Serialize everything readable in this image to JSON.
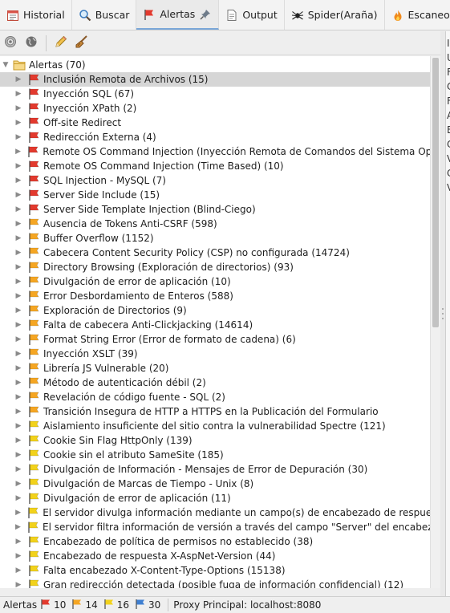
{
  "tabs": [
    {
      "label": "Historial",
      "icon": "history-icon"
    },
    {
      "label": "Buscar",
      "icon": "search-icon"
    },
    {
      "label": "Alertas",
      "icon": "alert-flag-icon"
    },
    {
      "label": "Output",
      "icon": "document-icon"
    },
    {
      "label": "Spider(Araña)",
      "icon": "spider-icon"
    },
    {
      "label": "Escaneo A",
      "icon": "flame-icon"
    }
  ],
  "toolbar": {
    "buttons": [
      "target-icon",
      "globe-icon",
      "pencil-icon",
      "broom-icon"
    ]
  },
  "tree": {
    "root_label": "Alertas (70)",
    "items": [
      {
        "label": "Inclusión Remota de Archivos (15)",
        "risk": "high"
      },
      {
        "label": "Inyección SQL (67)",
        "risk": "high"
      },
      {
        "label": "Inyección XPath (2)",
        "risk": "high"
      },
      {
        "label": "Off-site Redirect",
        "risk": "high"
      },
      {
        "label": "Redirección Externa (4)",
        "risk": "high"
      },
      {
        "label": "Remote OS Command Injection (Inyección Remota de Comandos del Sistema Operativ",
        "risk": "high"
      },
      {
        "label": "Remote OS Command Injection (Time Based) (10)",
        "risk": "high"
      },
      {
        "label": "SQL Injection - MySQL (7)",
        "risk": "high"
      },
      {
        "label": "Server Side Include (15)",
        "risk": "high"
      },
      {
        "label": "Server Side Template Injection (Blind-Ciego)",
        "risk": "high"
      },
      {
        "label": "Ausencia de Tokens Anti-CSRF (598)",
        "risk": "medium"
      },
      {
        "label": "Buffer Overflow (1152)",
        "risk": "medium"
      },
      {
        "label": "Cabecera Content Security Policy (CSP) no configurada (14724)",
        "risk": "medium"
      },
      {
        "label": "Directory Browsing (Exploración de directorios) (93)",
        "risk": "medium"
      },
      {
        "label": "Divulgación de error de aplicación (10)",
        "risk": "medium"
      },
      {
        "label": "Error Desbordamiento de Enteros (588)",
        "risk": "medium"
      },
      {
        "label": "Exploración de Directorios (9)",
        "risk": "medium"
      },
      {
        "label": "Falta de cabecera Anti-Clickjacking (14614)",
        "risk": "medium"
      },
      {
        "label": "Format String Error (Error de formato de cadena) (6)",
        "risk": "medium"
      },
      {
        "label": "Inyección XSLT (39)",
        "risk": "medium"
      },
      {
        "label": "Librería JS Vulnerable (20)",
        "risk": "medium"
      },
      {
        "label": "Método de autenticación débil (2)",
        "risk": "medium"
      },
      {
        "label": "Revelación de código fuente - SQL (2)",
        "risk": "medium"
      },
      {
        "label": "Transición Insegura de HTTP a HTTPS en la Publicación del Formulario",
        "risk": "medium"
      },
      {
        "label": "Aislamiento insuficiente del sitio contra la vulnerabilidad Spectre (121)",
        "risk": "low"
      },
      {
        "label": "Cookie Sin Flag HttpOnly (139)",
        "risk": "low"
      },
      {
        "label": "Cookie sin el atributo SameSite (185)",
        "risk": "low"
      },
      {
        "label": "Divulgación de Información - Mensajes de Error de Depuración (30)",
        "risk": "low"
      },
      {
        "label": "Divulgación de Marcas de Tiempo - Unix (8)",
        "risk": "low"
      },
      {
        "label": "Divulgación de error de aplicación (11)",
        "risk": "low"
      },
      {
        "label": "El servidor divulga información mediante un campo(s) de encabezado de respuesta HT",
        "risk": "low"
      },
      {
        "label": "El servidor filtra información de versión a través del campo \"Server\" del encabezado de r",
        "risk": "low"
      },
      {
        "label": "Encabezado de política de permisos no establecido (38)",
        "risk": "low"
      },
      {
        "label": "Encabezado de respuesta X-AspNet-Version (44)",
        "risk": "low"
      },
      {
        "label": "Falta encabezado X-Content-Type-Options (15138)",
        "risk": "low"
      },
      {
        "label": "Gran redirección detectada (posible fuga de información confidencial) (12)",
        "risk": "low"
      }
    ]
  },
  "right_panel_letters": [
    "I",
    "U",
    "F",
    "C",
    "F",
    "A",
    "E",
    "C",
    "V",
    "C",
    "V"
  ],
  "status": {
    "label": "Alertas",
    "counts": [
      {
        "value": "10",
        "risk": "high"
      },
      {
        "value": "14",
        "risk": "medium"
      },
      {
        "value": "16",
        "risk": "low"
      },
      {
        "value": "30",
        "risk": "info"
      }
    ],
    "proxy": "Proxy Principal: localhost:8080"
  },
  "colors": {
    "high": "#e23a2e",
    "medium": "#f5a623",
    "low": "#f2d21b",
    "info": "#3f7fd1",
    "selected_row": "#d6d6d6"
  }
}
